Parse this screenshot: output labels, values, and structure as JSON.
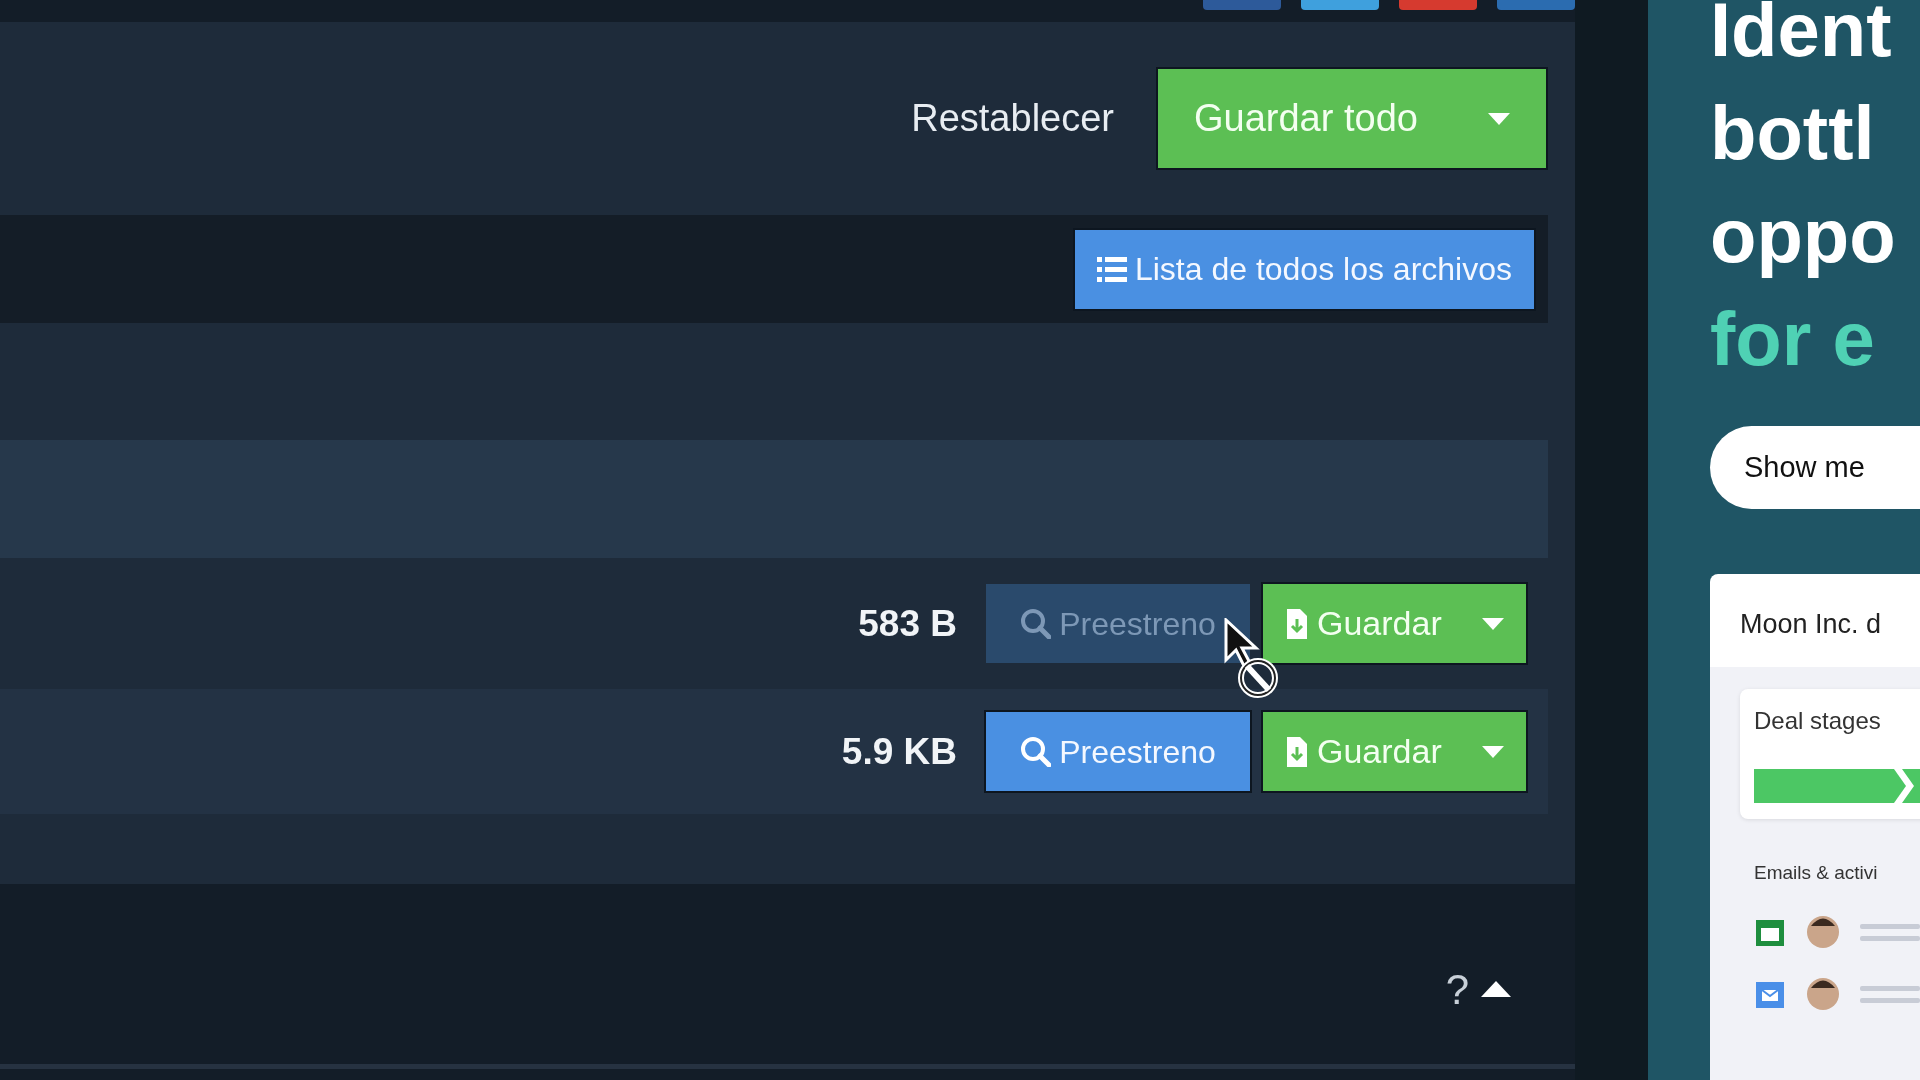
{
  "share_buttons": [
    {
      "color": "#2d5a9a"
    },
    {
      "color": "#3fa0dd"
    },
    {
      "color": "#d63a2f"
    },
    {
      "color": "#2b6cb0"
    }
  ],
  "toolbar": {
    "reset_link": "Restablecer",
    "save_all_button": "Guardar todo"
  },
  "file_list_button": "Lista de todos los archivos",
  "files": [
    {
      "size": "583 B",
      "preview": {
        "label": "Preestreno",
        "disabled": true
      },
      "save": {
        "label": "Guardar"
      }
    },
    {
      "size": "5.9 KB",
      "preview": {
        "label": "Preestreno",
        "disabled": false
      },
      "save": {
        "label": "Guardar"
      }
    }
  ],
  "footer": {
    "help": "?"
  },
  "ad": {
    "headline": [
      {
        "text": "Ident",
        "kind": "plain"
      },
      {
        "text": "bottl",
        "kind": "plain"
      },
      {
        "text": "oppo",
        "kind": "plain"
      },
      {
        "text": "for e",
        "kind": "accent"
      }
    ],
    "cta": "Show me",
    "card": {
      "title": "Moon Inc. d",
      "deal_stages": "Deal stages",
      "emails": "Emails & activi"
    }
  }
}
